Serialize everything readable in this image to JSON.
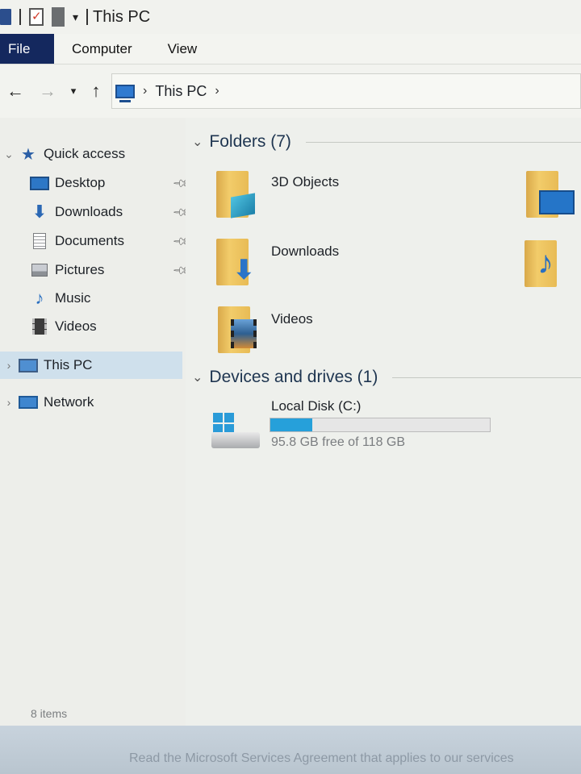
{
  "window": {
    "title": "This PC"
  },
  "ribbon": {
    "tabs": [
      "File",
      "Computer",
      "View"
    ]
  },
  "address": {
    "crumbs": [
      "This PC"
    ]
  },
  "sidebar": {
    "quick_access": "Quick access",
    "items": [
      {
        "label": "Desktop",
        "icon": "desktop-icon",
        "pinned": true
      },
      {
        "label": "Downloads",
        "icon": "downloads-icon",
        "pinned": true
      },
      {
        "label": "Documents",
        "icon": "documents-icon",
        "pinned": true
      },
      {
        "label": "Pictures",
        "icon": "pictures-icon",
        "pinned": true
      },
      {
        "label": "Music",
        "icon": "music-icon",
        "pinned": false
      },
      {
        "label": "Videos",
        "icon": "videos-icon",
        "pinned": false
      }
    ],
    "this_pc": "This PC",
    "network": "Network"
  },
  "main": {
    "folders_header": "Folders (7)",
    "folders": [
      {
        "label": "3D Objects",
        "icon": "3d-objects-icon"
      },
      {
        "label": "Downloads",
        "icon": "downloads-folder-icon"
      },
      {
        "label": "Videos",
        "icon": "videos-folder-icon"
      }
    ],
    "devices_header": "Devices and drives (1)",
    "drive": {
      "label": "Local Disk (C:)",
      "free_text": "95.8 GB free of 118 GB",
      "used_fraction": 0.19
    }
  },
  "status": {
    "items": "8 items"
  },
  "bottom_notice": "Read the Microsoft Services Agreement that applies to our services",
  "colors": {
    "accent": "#26a0da",
    "file_tab": "#14285e",
    "selection": "#cfe0ec"
  }
}
